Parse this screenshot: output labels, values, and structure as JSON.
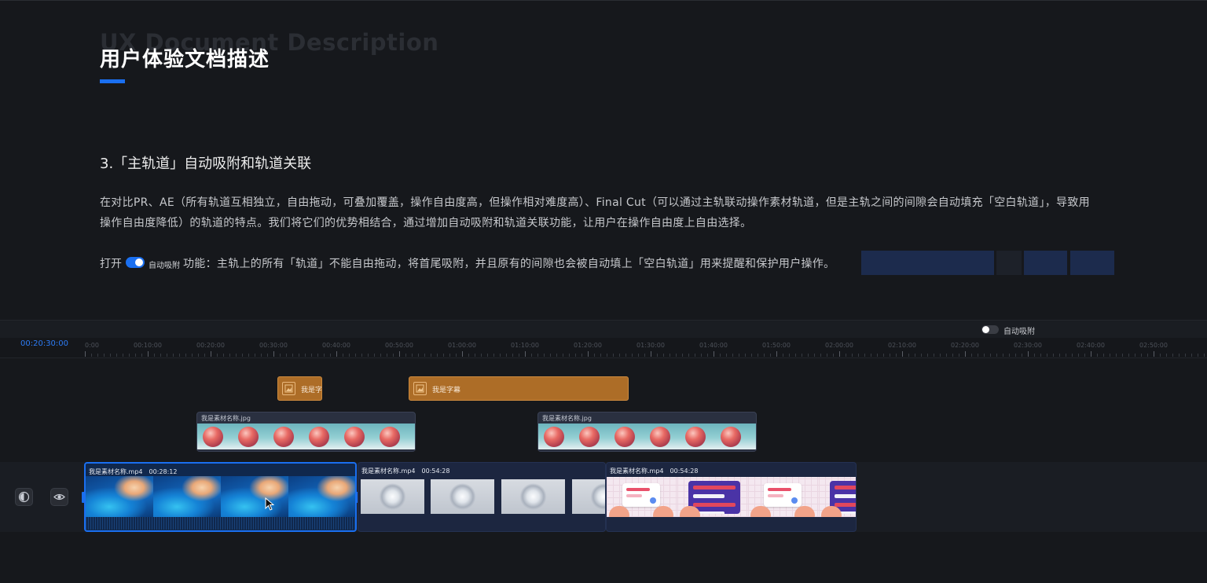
{
  "document": {
    "watermark": "UX Document Description",
    "title": "用户体验文档描述",
    "section_heading": "3.「主轨道」自动吸附和轨道关联",
    "paragraph": [
      "在对比PR、AE（所有轨道互相独立，自由拖动，可叠加覆盖，操作自由度高，但操作相对难度高）、Final Cut（可以通过主轨联动操作素材轨道，但是主轨之间的间隙会自动填充「空白轨道」，导致用",
      "操作自由度降低）的轨道的特点。我们将它们的优势相结合，通过增加自动吸附和轨道关联功能，让用户在操作自由度上自由选择。"
    ],
    "feature": {
      "prefix": "打开",
      "toggle_label": "自动吸附",
      "toggle_on": true,
      "description": "功能：主轨上的所有「轨道」不能自由拖动，将首尾吸附，并且原有的间隙也会被自动填上「空白轨道」用来提醒和保护用户操作。"
    }
  },
  "timeline": {
    "snap_toggle": {
      "label": "自动吸附",
      "on": false
    },
    "current_time": "00:20:30:00",
    "ruler_labels": [
      "0:00",
      "00:10:00",
      "00:20:00",
      "00:30:00",
      "00:40:00",
      "00:50:00",
      "01:00:00",
      "01:10:00",
      "01:20:00",
      "01:30:00",
      "01:40:00",
      "01:50:00",
      "02:00:00",
      "02:10:00",
      "02:20:00",
      "02:30:00",
      "02:40:00",
      "02:50:00"
    ],
    "track_controls": [
      {
        "icon": "volume-icon"
      },
      {
        "icon": "eye-icon"
      }
    ],
    "caption_clips": [
      {
        "label": "我是字"
      },
      {
        "label": "我是字幕"
      }
    ],
    "image_clips": [
      {
        "label": "我是素材名称.jpg"
      },
      {
        "label": "我是素材名称.jpg"
      }
    ],
    "main_clips": [
      {
        "name": "我是素材名称.mp4",
        "duration": "00:28:12",
        "selected": true
      },
      {
        "name": "我是素材名称.mp4",
        "duration": "00:54:28",
        "selected": false
      },
      {
        "name": "我是素材名称.mp4",
        "duration": "00:54:28",
        "selected": false
      }
    ]
  },
  "colors": {
    "accent": "#1a6ff0",
    "caption_clip": "#ad6d27",
    "main_clip": "#1c2640",
    "background": "#16181c"
  }
}
